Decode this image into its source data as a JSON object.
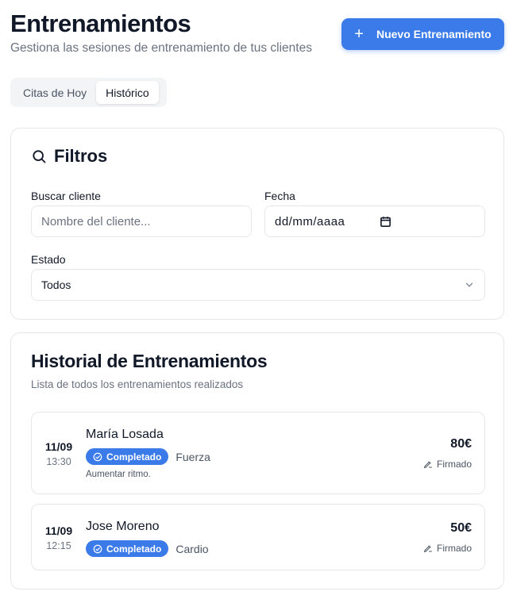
{
  "header": {
    "title": "Entrenamientos",
    "subtitle": "Gestiona las sesiones de entrenamiento de tus clientes",
    "new_button_label": "Nuevo Entrenamiento",
    "new_button_icon": "plus-icon",
    "accent_color": "#3b7be9"
  },
  "tabs": [
    {
      "label": "Citas de Hoy",
      "active": false
    },
    {
      "label": "Histórico",
      "active": true
    }
  ],
  "filters": {
    "title": "Filtros",
    "icon": "search-icon",
    "client_label": "Buscar cliente",
    "client_placeholder": "Nombre del cliente...",
    "date_label": "Fecha",
    "date_value": "dd/mm/aaaa",
    "date_icon": "calendar-icon",
    "status_label": "Estado",
    "status_value": "Todos",
    "status_icon": "chevron-down-icon"
  },
  "history": {
    "title": "Historial de Entrenamientos",
    "subtitle": "Lista de todos los entrenamientos realizados",
    "sessions": [
      {
        "day": "11/09",
        "time": "13:30",
        "client": "María Losada",
        "status": "Completado",
        "type": "Fuerza",
        "note": "Aumentar ritmo.",
        "price": "80€",
        "signature": "Firmado"
      },
      {
        "day": "11/09",
        "time": "12:15",
        "client": "Jose Moreno",
        "status": "Completado",
        "type": "Cardio",
        "price": "50€",
        "signature": "Firmado"
      }
    ]
  }
}
